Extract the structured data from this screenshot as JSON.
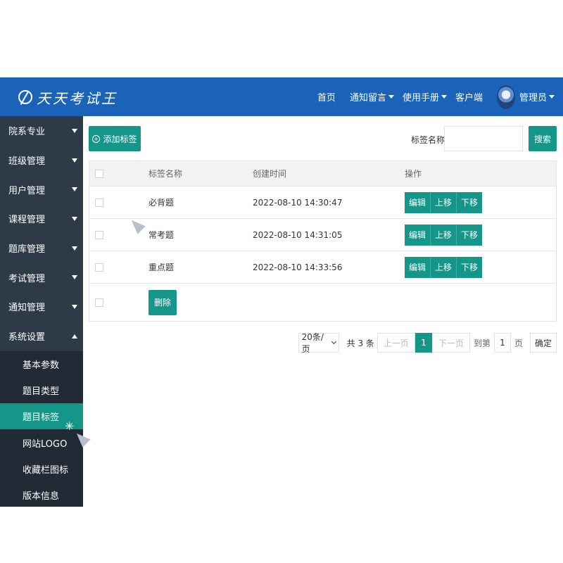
{
  "header": {
    "logo_text": "天天考试王",
    "nav": {
      "home": "首页",
      "notice": "通知留言",
      "manual": "使用手册",
      "client": "客户端",
      "user": "管理员"
    }
  },
  "sidebar": {
    "groups": [
      "院系专业",
      "班级管理",
      "用户管理",
      "课程管理",
      "题库管理",
      "考试管理",
      "通知管理",
      "系统设置"
    ],
    "sub_items": [
      "基本参数",
      "题目类型",
      "题目标签",
      "网站LOGO",
      "收藏栏图标",
      "版本信息"
    ],
    "active_sub": "题目标签"
  },
  "toolbar": {
    "add_label": "添加标签",
    "search_label": "标签名称",
    "search_value": "",
    "search_button": "搜索"
  },
  "table": {
    "headers": {
      "name": "标签名称",
      "time": "创建时间",
      "ops": "操作"
    },
    "rows": [
      {
        "name": "必背题",
        "time": "2022-08-10 14:30:47"
      },
      {
        "name": "常考题",
        "time": "2022-08-10 14:31:05"
      },
      {
        "name": "重点题",
        "time": "2022-08-10 14:33:56"
      }
    ],
    "ops": {
      "edit": "编辑",
      "up": "上移",
      "down": "下移"
    },
    "delete_label": "删除"
  },
  "pager": {
    "page_size": "20条/页",
    "total": "共 3 条",
    "prev": "上一页",
    "current": "1",
    "next": "下一页",
    "goto_prefix": "到第",
    "goto_value": "1",
    "goto_suffix": "页",
    "confirm": "确定"
  }
}
